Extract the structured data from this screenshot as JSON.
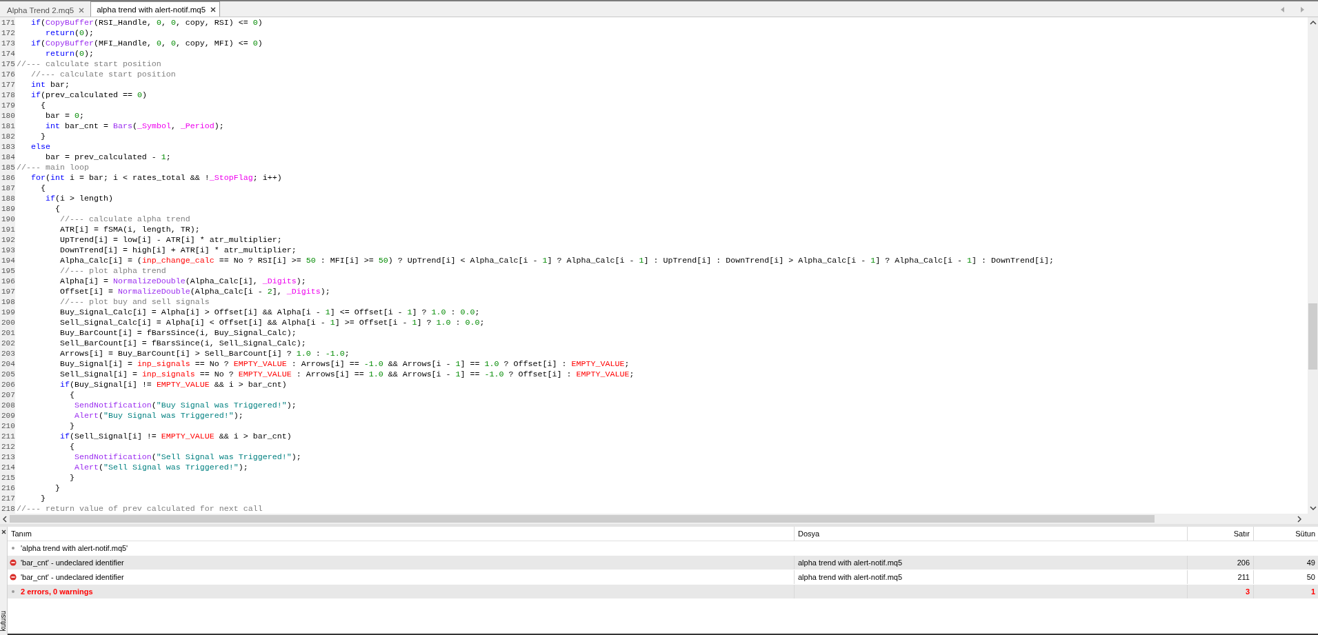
{
  "tabs": [
    {
      "label": "Alpha Trend 2.mq5",
      "selected": false
    },
    {
      "label": "alpha trend with alert-notif.mq5",
      "selected": true
    }
  ],
  "lines": [
    {
      "number": "171",
      "code": [
        {
          "kind": "keyword",
          "text": "   if"
        },
        "(",
        {
          "kind": "function",
          "text": "CopyBuffer"
        },
        "(RSI_Handle, ",
        {
          "kind": "number",
          "text": "0"
        },
        ", ",
        {
          "kind": "number",
          "text": "0"
        },
        ", copy, RSI) <= ",
        {
          "kind": "number",
          "text": "0"
        },
        ")"
      ]
    },
    {
      "number": "172",
      "code": [
        {
          "kind": "keyword",
          "text": "      return"
        },
        "(",
        {
          "kind": "number",
          "text": "0"
        },
        ");"
      ]
    },
    {
      "number": "173",
      "code": [
        {
          "kind": "keyword",
          "text": "   if"
        },
        "(",
        {
          "kind": "function",
          "text": "CopyBuffer"
        },
        "(MFI_Handle, ",
        {
          "kind": "number",
          "text": "0"
        },
        ", ",
        {
          "kind": "number",
          "text": "0"
        },
        ", copy, MFI) <= ",
        {
          "kind": "number",
          "text": "0"
        },
        ")"
      ]
    },
    {
      "number": "174",
      "code": [
        {
          "kind": "keyword",
          "text": "      return"
        },
        "(",
        {
          "kind": "number",
          "text": "0"
        },
        ");"
      ]
    },
    {
      "number": "175",
      "code": [
        {
          "kind": "comment",
          "text": "//--- calculate start position"
        }
      ]
    },
    {
      "number": "176",
      "code": [
        {
          "kind": "comment",
          "text": "   //--- calculate start position"
        }
      ]
    },
    {
      "number": "177",
      "code": [
        {
          "kind": "keyword",
          "text": "   int"
        },
        " bar;"
      ]
    },
    {
      "number": "178",
      "code": [
        {
          "kind": "keyword",
          "text": "   if"
        },
        "(prev_calculated == ",
        {
          "kind": "number",
          "text": "0"
        },
        ")"
      ]
    },
    {
      "number": "179",
      "code": [
        "     {"
      ]
    },
    {
      "number": "180",
      "code": [
        "      bar = ",
        {
          "kind": "number",
          "text": "0"
        },
        ";"
      ]
    },
    {
      "number": "181",
      "code": [
        {
          "kind": "keyword",
          "text": "      int"
        },
        " bar_cnt = ",
        {
          "kind": "function",
          "text": "Bars"
        },
        "(",
        {
          "kind": "builtin",
          "text": "_Symbol"
        },
        ", ",
        {
          "kind": "builtin",
          "text": "_Period"
        },
        ");"
      ]
    },
    {
      "number": "182",
      "code": [
        "     }"
      ]
    },
    {
      "number": "183",
      "code": [
        {
          "kind": "keyword",
          "text": "   else"
        }
      ]
    },
    {
      "number": "184",
      "code": [
        "      bar = prev_calculated - ",
        {
          "kind": "number",
          "text": "1"
        },
        ";"
      ]
    },
    {
      "number": "185",
      "code": [
        {
          "kind": "comment",
          "text": "//--- main loop"
        }
      ]
    },
    {
      "number": "186",
      "code": [
        {
          "kind": "keyword",
          "text": "   for"
        },
        "(",
        {
          "kind": "keyword",
          "text": "int"
        },
        " i = bar; i < rates_total && !",
        {
          "kind": "builtin",
          "text": "_StopFlag"
        },
        "; i++)"
      ]
    },
    {
      "number": "187",
      "code": [
        "     {"
      ]
    },
    {
      "number": "188",
      "code": [
        {
          "kind": "keyword",
          "text": "      if"
        },
        "(i > length)"
      ]
    },
    {
      "number": "189",
      "code": [
        "        {"
      ]
    },
    {
      "number": "190",
      "code": [
        {
          "kind": "comment",
          "text": "         //--- calculate alpha trend"
        }
      ]
    },
    {
      "number": "191",
      "code": [
        "         ATR[i] = fSMA(i, length, TR);"
      ]
    },
    {
      "number": "192",
      "code": [
        "         UpTrend[i] = low[i] - ATR[i] * atr_multiplier;"
      ]
    },
    {
      "number": "193",
      "code": [
        "         DownTrend[i] = high[i] + ATR[i] * atr_multiplier;"
      ]
    },
    {
      "number": "194",
      "code": [
        "         Alpha_Calc[i] = (",
        {
          "kind": "input",
          "text": "inp_change_calc"
        },
        " == No ? RSI[i] >= ",
        {
          "kind": "number",
          "text": "50"
        },
        " : MFI[i] >= ",
        {
          "kind": "number",
          "text": "50"
        },
        ") ? UpTrend[i] < Alpha_Calc[i - ",
        {
          "kind": "number",
          "text": "1"
        },
        "] ? Alpha_Calc[i - ",
        {
          "kind": "number",
          "text": "1"
        },
        "] : UpTrend[i] : DownTrend[i] > Alpha_Calc[i - ",
        {
          "kind": "number",
          "text": "1"
        },
        "] ? Alpha_Calc[i - ",
        {
          "kind": "number",
          "text": "1"
        },
        "] : DownTrend[i];"
      ]
    },
    {
      "number": "195",
      "code": [
        {
          "kind": "comment",
          "text": "         //--- plot alpha trend"
        }
      ]
    },
    {
      "number": "196",
      "code": [
        "         Alpha[i] = ",
        {
          "kind": "function",
          "text": "NormalizeDouble"
        },
        "(Alpha_Calc[i], ",
        {
          "kind": "builtin",
          "text": "_Digits"
        },
        ");"
      ]
    },
    {
      "number": "197",
      "code": [
        "         Offset[i] = ",
        {
          "kind": "function",
          "text": "NormalizeDouble"
        },
        "(Alpha_Calc[i - ",
        {
          "kind": "number",
          "text": "2"
        },
        "], ",
        {
          "kind": "builtin",
          "text": "_Digits"
        },
        ");"
      ]
    },
    {
      "number": "198",
      "code": [
        {
          "kind": "comment",
          "text": "         //--- plot buy and sell signals"
        }
      ]
    },
    {
      "number": "199",
      "code": [
        "         Buy_Signal_Calc[i] = Alpha[i] > Offset[i] && Alpha[i - ",
        {
          "kind": "number",
          "text": "1"
        },
        "] <= Offset[i - ",
        {
          "kind": "number",
          "text": "1"
        },
        "] ? ",
        {
          "kind": "number",
          "text": "1.0"
        },
        " : ",
        {
          "kind": "number",
          "text": "0.0"
        },
        ";"
      ]
    },
    {
      "number": "200",
      "code": [
        "         Sell_Signal_Calc[i] = Alpha[i] < Offset[i] && Alpha[i - ",
        {
          "kind": "number",
          "text": "1"
        },
        "] >= Offset[i - ",
        {
          "kind": "number",
          "text": "1"
        },
        "] ? ",
        {
          "kind": "number",
          "text": "1.0"
        },
        " : ",
        {
          "kind": "number",
          "text": "0.0"
        },
        ";"
      ]
    },
    {
      "number": "201",
      "code": [
        "         Buy_BarCount[i] = fBarsSince(i, Buy_Signal_Calc);"
      ]
    },
    {
      "number": "202",
      "code": [
        "         Sell_BarCount[i] = fBarsSince(i, Sell_Signal_Calc);"
      ]
    },
    {
      "number": "203",
      "code": [
        "         Arrows[i] = Buy_BarCount[i] > Sell_BarCount[i] ? ",
        {
          "kind": "number",
          "text": "1.0"
        },
        " : ",
        {
          "kind": "number",
          "text": "-1.0"
        },
        ";"
      ]
    },
    {
      "number": "204",
      "code": [
        "         Buy_Signal[i] = ",
        {
          "kind": "input",
          "text": "inp_signals"
        },
        " == No ? ",
        {
          "kind": "input",
          "text": "EMPTY_VALUE"
        },
        " : Arrows[i] == ",
        {
          "kind": "number",
          "text": "-1.0"
        },
        " && Arrows[i - ",
        {
          "kind": "number",
          "text": "1"
        },
        "] == ",
        {
          "kind": "number",
          "text": "1.0"
        },
        " ? Offset[i] : ",
        {
          "kind": "input",
          "text": "EMPTY_VALUE"
        },
        ";"
      ]
    },
    {
      "number": "205",
      "code": [
        "         Sell_Signal[i] = ",
        {
          "kind": "input",
          "text": "inp_signals"
        },
        " == No ? ",
        {
          "kind": "input",
          "text": "EMPTY_VALUE"
        },
        " : Arrows[i] == ",
        {
          "kind": "number",
          "text": "1.0"
        },
        " && Arrows[i - ",
        {
          "kind": "number",
          "text": "1"
        },
        "] == ",
        {
          "kind": "number",
          "text": "-1.0"
        },
        " ? Offset[i] : ",
        {
          "kind": "input",
          "text": "EMPTY_VALUE"
        },
        ";"
      ]
    },
    {
      "number": "206",
      "code": [
        {
          "kind": "keyword",
          "text": "         if"
        },
        "(Buy_Signal[i] != ",
        {
          "kind": "input",
          "text": "EMPTY_VALUE"
        },
        " && i > bar_cnt)"
      ]
    },
    {
      "number": "207",
      "code": [
        "           {"
      ]
    },
    {
      "number": "208",
      "code": [
        {
          "kind": "function",
          "text": "            SendNotification"
        },
        "(",
        {
          "kind": "string",
          "text": "\"Buy Signal was Triggered!\""
        },
        ");"
      ]
    },
    {
      "number": "209",
      "code": [
        {
          "kind": "function",
          "text": "            Alert"
        },
        "(",
        {
          "kind": "string",
          "text": "\"Buy Signal was Triggered!\""
        },
        ");"
      ]
    },
    {
      "number": "210",
      "code": [
        "           }"
      ]
    },
    {
      "number": "211",
      "code": [
        {
          "kind": "keyword",
          "text": "         if"
        },
        "(Sell_Signal[i] != ",
        {
          "kind": "input",
          "text": "EMPTY_VALUE"
        },
        " && i > bar_cnt)"
      ]
    },
    {
      "number": "212",
      "code": [
        "           {"
      ]
    },
    {
      "number": "213",
      "code": [
        {
          "kind": "function",
          "text": "            SendNotification"
        },
        "(",
        {
          "kind": "string",
          "text": "\"Sell Signal was Triggered!\""
        },
        ");"
      ]
    },
    {
      "number": "214",
      "code": [
        {
          "kind": "function",
          "text": "            Alert"
        },
        "(",
        {
          "kind": "string",
          "text": "\"Sell Signal was Triggered!\""
        },
        ");"
      ]
    },
    {
      "number": "215",
      "code": [
        "           }"
      ]
    },
    {
      "number": "216",
      "code": [
        "        }"
      ]
    },
    {
      "number": "217",
      "code": [
        "     }"
      ]
    },
    {
      "number": "218",
      "code": [
        {
          "kind": "comment",
          "text": "//--- return value of prev calculated for next call"
        }
      ]
    }
  ],
  "toolbox_label": "kutusu",
  "messages": {
    "columns": [
      "Tanım",
      "Dosya",
      "Satır",
      "Sütun"
    ],
    "rows": [
      {
        "kind": "file",
        "description": "'alpha trend with alert-notif.mq5'",
        "selected": false
      },
      {
        "kind": "error",
        "description": "'bar_cnt' - undeclared identifier",
        "file": "alpha trend with alert-notif.mq5",
        "line": "206",
        "column": "49",
        "selected": true
      },
      {
        "kind": "error",
        "description": "'bar_cnt' - undeclared identifier",
        "file": "alpha trend with alert-notif.mq5",
        "line": "211",
        "column": "50",
        "selected": false
      },
      {
        "kind": "summary",
        "description": "2 errors, 0 warnings",
        "line": "3",
        "column": "1",
        "selected": true
      }
    ]
  }
}
